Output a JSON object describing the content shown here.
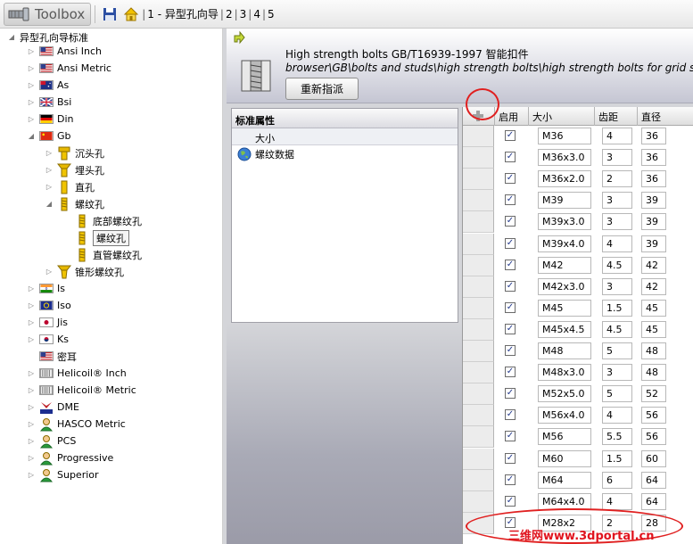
{
  "toolbar": {
    "title": "Toolbox",
    "step1": "1 - 异型孔向导",
    "step2": "2",
    "step3": "3",
    "step4": "4",
    "step5": "5",
    "sep": "|"
  },
  "tree": {
    "root": "异型孔向导标准",
    "items": [
      {
        "label": "Ansi Inch"
      },
      {
        "label": "Ansi Metric"
      },
      {
        "label": "As"
      },
      {
        "label": "Bsi"
      },
      {
        "label": "Din"
      },
      {
        "label": "Gb"
      },
      {
        "label": "沉头孔"
      },
      {
        "label": "埋头孔"
      },
      {
        "label": "直孔"
      },
      {
        "label": "螺纹孔"
      },
      {
        "label": "底部螺纹孔"
      },
      {
        "label": "螺纹孔"
      },
      {
        "label": "直管螺纹孔"
      },
      {
        "label": "锥形螺纹孔"
      },
      {
        "label": "Is"
      },
      {
        "label": "Iso"
      },
      {
        "label": "Jis"
      },
      {
        "label": "Ks"
      },
      {
        "label": "密耳"
      },
      {
        "label": "Helicoil® Inch"
      },
      {
        "label": "Helicoil® Metric"
      },
      {
        "label": "DME"
      },
      {
        "label": "HASCO Metric"
      },
      {
        "label": "PCS"
      },
      {
        "label": "Progressive"
      },
      {
        "label": "Superior"
      }
    ]
  },
  "header": {
    "title": "High strength bolts GB/T16939-1997 智能扣件",
    "path": "browser\\GB\\bolts and studs\\high strength bolts\\high strength bolts for grid structures",
    "reassign_label": "重新指派"
  },
  "properties": {
    "heading": "标准属性",
    "size_label": "大小",
    "thread_label": "螺纹数据"
  },
  "grid": {
    "headers": {
      "enable": "启用",
      "size": "大小",
      "pitch": "齿距",
      "diameter": "直径"
    },
    "check_mark": "✓",
    "rows": [
      {
        "size": "M36",
        "pitch": "4",
        "dia": "36"
      },
      {
        "size": "M36x3.0",
        "pitch": "3",
        "dia": "36"
      },
      {
        "size": "M36x2.0",
        "pitch": "2",
        "dia": "36"
      },
      {
        "size": "M39",
        "pitch": "3",
        "dia": "39"
      },
      {
        "size": "M39x3.0",
        "pitch": "3",
        "dia": "39"
      },
      {
        "size": "M39x4.0",
        "pitch": "4",
        "dia": "39"
      },
      {
        "size": "M42",
        "pitch": "4.5",
        "dia": "42"
      },
      {
        "size": "M42x3.0",
        "pitch": "3",
        "dia": "42"
      },
      {
        "size": "M45",
        "pitch": "1.5",
        "dia": "45"
      },
      {
        "size": "M45x4.5",
        "pitch": "4.5",
        "dia": "45"
      },
      {
        "size": "M48",
        "pitch": "5",
        "dia": "48"
      },
      {
        "size": "M48x3.0",
        "pitch": "3",
        "dia": "48"
      },
      {
        "size": "M52x5.0",
        "pitch": "5",
        "dia": "52"
      },
      {
        "size": "M56x4.0",
        "pitch": "4",
        "dia": "56"
      },
      {
        "size": "M56",
        "pitch": "5.5",
        "dia": "56"
      },
      {
        "size": "M60",
        "pitch": "1.5",
        "dia": "60"
      },
      {
        "size": "M64",
        "pitch": "6",
        "dia": "64"
      },
      {
        "size": "M64x4.0",
        "pitch": "4",
        "dia": "64"
      },
      {
        "size": "M28x2",
        "pitch": "2",
        "dia": "28"
      }
    ]
  },
  "watermark": "三维网www.3dportal.cn"
}
